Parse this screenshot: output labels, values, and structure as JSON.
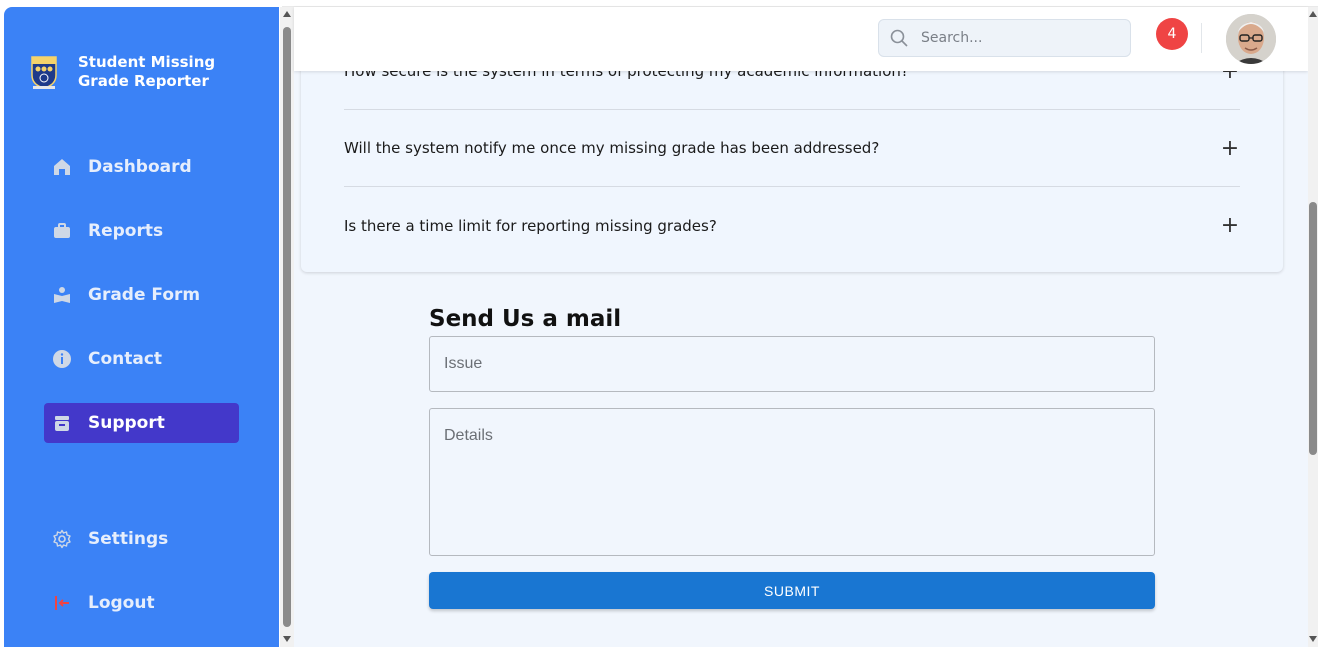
{
  "app": {
    "title": "Student Missing Grade Reporter"
  },
  "sidebar": {
    "items": [
      {
        "label": "Dashboard",
        "icon": "home-icon"
      },
      {
        "label": "Reports",
        "icon": "briefcase-icon"
      },
      {
        "label": "Grade Form",
        "icon": "book-reader-icon"
      },
      {
        "label": "Contact",
        "icon": "info-icon"
      },
      {
        "label": "Support",
        "icon": "archive-icon",
        "active": true
      },
      {
        "label": "Settings",
        "icon": "gear-icon"
      },
      {
        "label": "Logout",
        "icon": "logout-icon"
      }
    ]
  },
  "header": {
    "search_placeholder": "Search...",
    "notification_count": "4"
  },
  "faq": {
    "items": [
      {
        "question": "How secure is the system in terms of protecting my academic information?"
      },
      {
        "question": "Will the system notify me once my missing grade has been addressed?"
      },
      {
        "question": "Is there a time limit for reporting missing grades?"
      }
    ]
  },
  "mail_form": {
    "title": "Send Us a mail",
    "issue_placeholder": "Issue",
    "details_placeholder": "Details",
    "submit_label": "SUBMIT"
  },
  "colors": {
    "sidebar_bg": "#3b82f6",
    "active_item_bg": "#4338ca",
    "submit_bg": "#1976d2",
    "badge_bg": "#ef4444",
    "logout_icon": "#ef4444"
  }
}
